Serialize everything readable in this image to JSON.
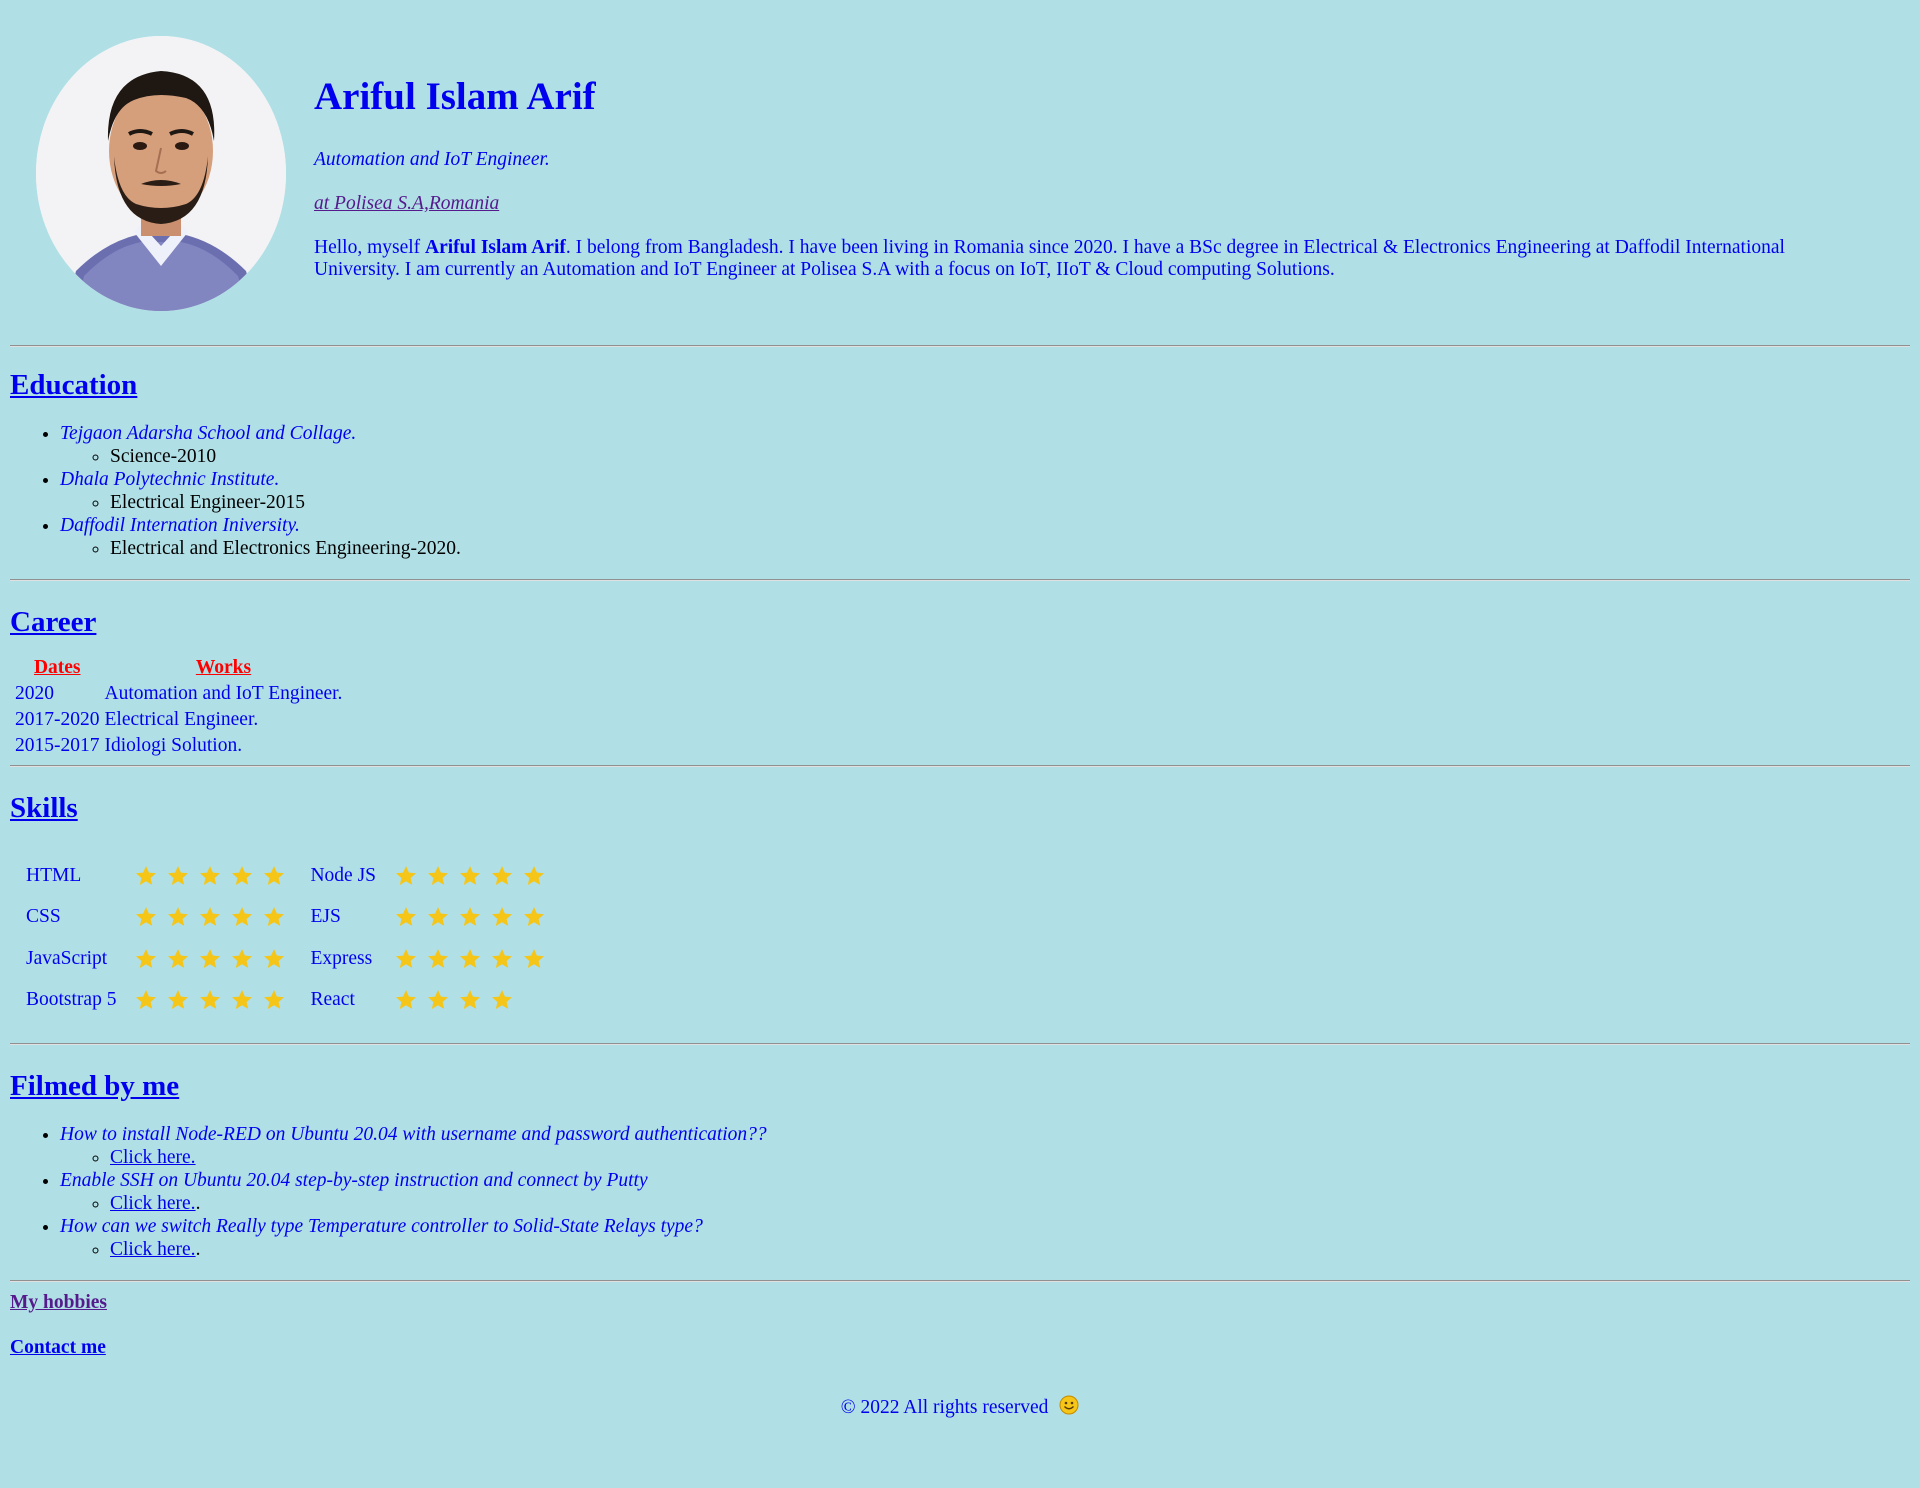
{
  "profile": {
    "name": "Ariful Islam Arif",
    "role": "Automation and IoT Engineer.",
    "company": "at Polisea S.A,Romania",
    "bio_prefix": "Hello, myself ",
    "bio_name": "Ariful Islam Arif",
    "bio_suffix": ". I belong from Bangladesh. I have been living in Romania since 2020. I have a BSc degree in Electrical & Electronics Engineering at Daffodil International University. I am currently an Automation and IoT Engineer at Polisea S.A with a focus on IoT, IIoT & Cloud computing Solutions."
  },
  "education": {
    "title": "Education",
    "items": [
      {
        "school": "Tejgaon Adarsha School and Collage.",
        "detail": "Science-2010"
      },
      {
        "school": "Dhala Polytechnic Institute.",
        "detail": "Electrical Engineer-2015"
      },
      {
        "school": "Daffodil Internation Iniversity.",
        "detail": "Electrical and Electronics Engineering-2020."
      }
    ]
  },
  "career": {
    "title": "Career",
    "headers": {
      "dates": "Dates",
      "works": "Works"
    },
    "rows": [
      {
        "date": "2020",
        "work": "Automation and IoT Engineer."
      },
      {
        "date": "2017-2020",
        "work": "Electrical Engineer."
      },
      {
        "date": "2015-2017",
        "work": "Idiologi Solution."
      }
    ]
  },
  "skills": {
    "title": "Skills",
    "star_color": "#f5c518",
    "rows": [
      {
        "left": {
          "name": "HTML",
          "stars": 5
        },
        "right": {
          "name": "Node JS",
          "stars": 5
        }
      },
      {
        "left": {
          "name": "CSS",
          "stars": 5
        },
        "right": {
          "name": "EJS",
          "stars": 5
        }
      },
      {
        "left": {
          "name": "JavaScript",
          "stars": 5
        },
        "right": {
          "name": "Express",
          "stars": 5
        }
      },
      {
        "left": {
          "name": "Bootstrap 5",
          "stars": 5
        },
        "right": {
          "name": "React",
          "stars": 4
        }
      }
    ]
  },
  "filmed": {
    "title": "Filmed by me",
    "items": [
      {
        "title": "How to install Node-RED on Ubuntu 20.04 with username and password authentication??",
        "link": "Click here.",
        "trail": ""
      },
      {
        "title": "Enable SSH on Ubuntu 20.04 step-by-step instruction and connect by Putty",
        "link": "Click here.",
        "trail": "."
      },
      {
        "title": "How can we switch Really type Temperature controller to Solid-State Relays type?",
        "link": "Click here.",
        "trail": "."
      }
    ]
  },
  "links": {
    "hobbies": "My hobbies",
    "contact": "Contact me"
  },
  "footer": {
    "text": "© 2022 All rights reserved",
    "icon": "smiley-icon"
  }
}
